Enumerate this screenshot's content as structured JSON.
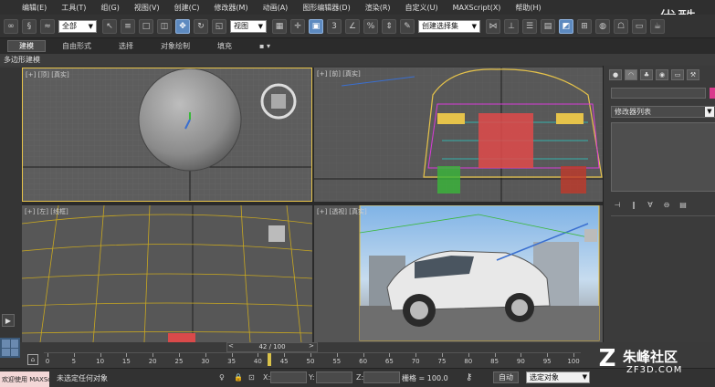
{
  "menu": [
    "编辑(E)",
    "工具(T)",
    "组(G)",
    "视图(V)",
    "创建(C)",
    "修改器(M)",
    "动画(A)",
    "图形编辑器(D)",
    "渲染(R)",
    "自定义(U)",
    "MAXScript(X)",
    "帮助(H)"
  ],
  "brand": "优酷",
  "toolbar": {
    "selection_filter": "全部",
    "ref_coord": "视图",
    "named_selection": "创建选择集",
    "snap_label": "3",
    "angle_snap_label": "%"
  },
  "ribbon": {
    "tabs": [
      "建模",
      "自由形式",
      "选择",
      "对象绘制",
      "填充"
    ],
    "active": "建模"
  },
  "subtab": "多边形建模",
  "viewports": {
    "top": "[+] [顶] [真实]",
    "front": "[+] [前] [真实]",
    "left": "[+] [左] [线框]",
    "persp": "[+] [透视] [真实]"
  },
  "command_panel": {
    "tab_icons": [
      "create-icon",
      "modify-icon",
      "hierarchy-icon",
      "motion-icon",
      "display-icon",
      "utilities-icon"
    ],
    "modifier_list": "修改器列表",
    "swatch_color": "#d93b8c"
  },
  "timeline": {
    "frame": "42 / 100",
    "prev": "<",
    "next": ">",
    "ticks": [
      0,
      5,
      10,
      15,
      20,
      25,
      30,
      35,
      40,
      45,
      50,
      55,
      60,
      65,
      70,
      75,
      80,
      85,
      90,
      95,
      100
    ]
  },
  "status": {
    "script_listener": "欢迎使用 MAXSc",
    "message": "未选定任何对象",
    "x_label": "X:",
    "y_label": "Y:",
    "z_label": "Z:",
    "grid": "栅格 = 100.0",
    "auto_key": "自动",
    "set_key_filter": "选定对象"
  },
  "watermark": {
    "logo": "Z",
    "title": "朱峰社区",
    "url": "ZF3D.COM"
  },
  "accent": "#5d8ac0",
  "selection_border": "#e6c34a"
}
